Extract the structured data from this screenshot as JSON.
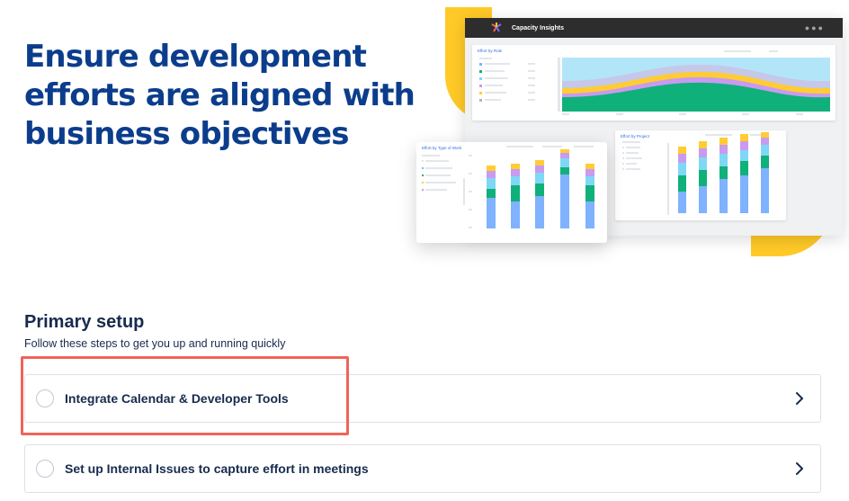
{
  "hero": {
    "title": "Ensure development efforts are aligned with business objectives"
  },
  "dashboard": {
    "app_title": "Capacity Insights",
    "panels": [
      {
        "title": "Effort by Role"
      },
      {
        "title": "Effort by Project"
      },
      {
        "title": "Effort by Type of Work"
      }
    ],
    "colors": {
      "blue": "#7fb2ff",
      "green": "#10b07a",
      "teal": "#7ed8f5",
      "purple": "#c89af0",
      "yellow": "#ffcc33",
      "accent_yellow": "#ffc927",
      "header": "#2d2d2d"
    }
  },
  "setup": {
    "title": "Primary setup",
    "subtitle": "Follow these steps to get you up and running quickly",
    "steps": [
      {
        "label": "Integrate Calendar & Developer Tools",
        "icon": "chevron-right-icon",
        "highlighted": true
      },
      {
        "label": "Set up Internal Issues to capture effort in meetings",
        "icon": "chevron-right-icon",
        "highlighted": false
      }
    ]
  }
}
